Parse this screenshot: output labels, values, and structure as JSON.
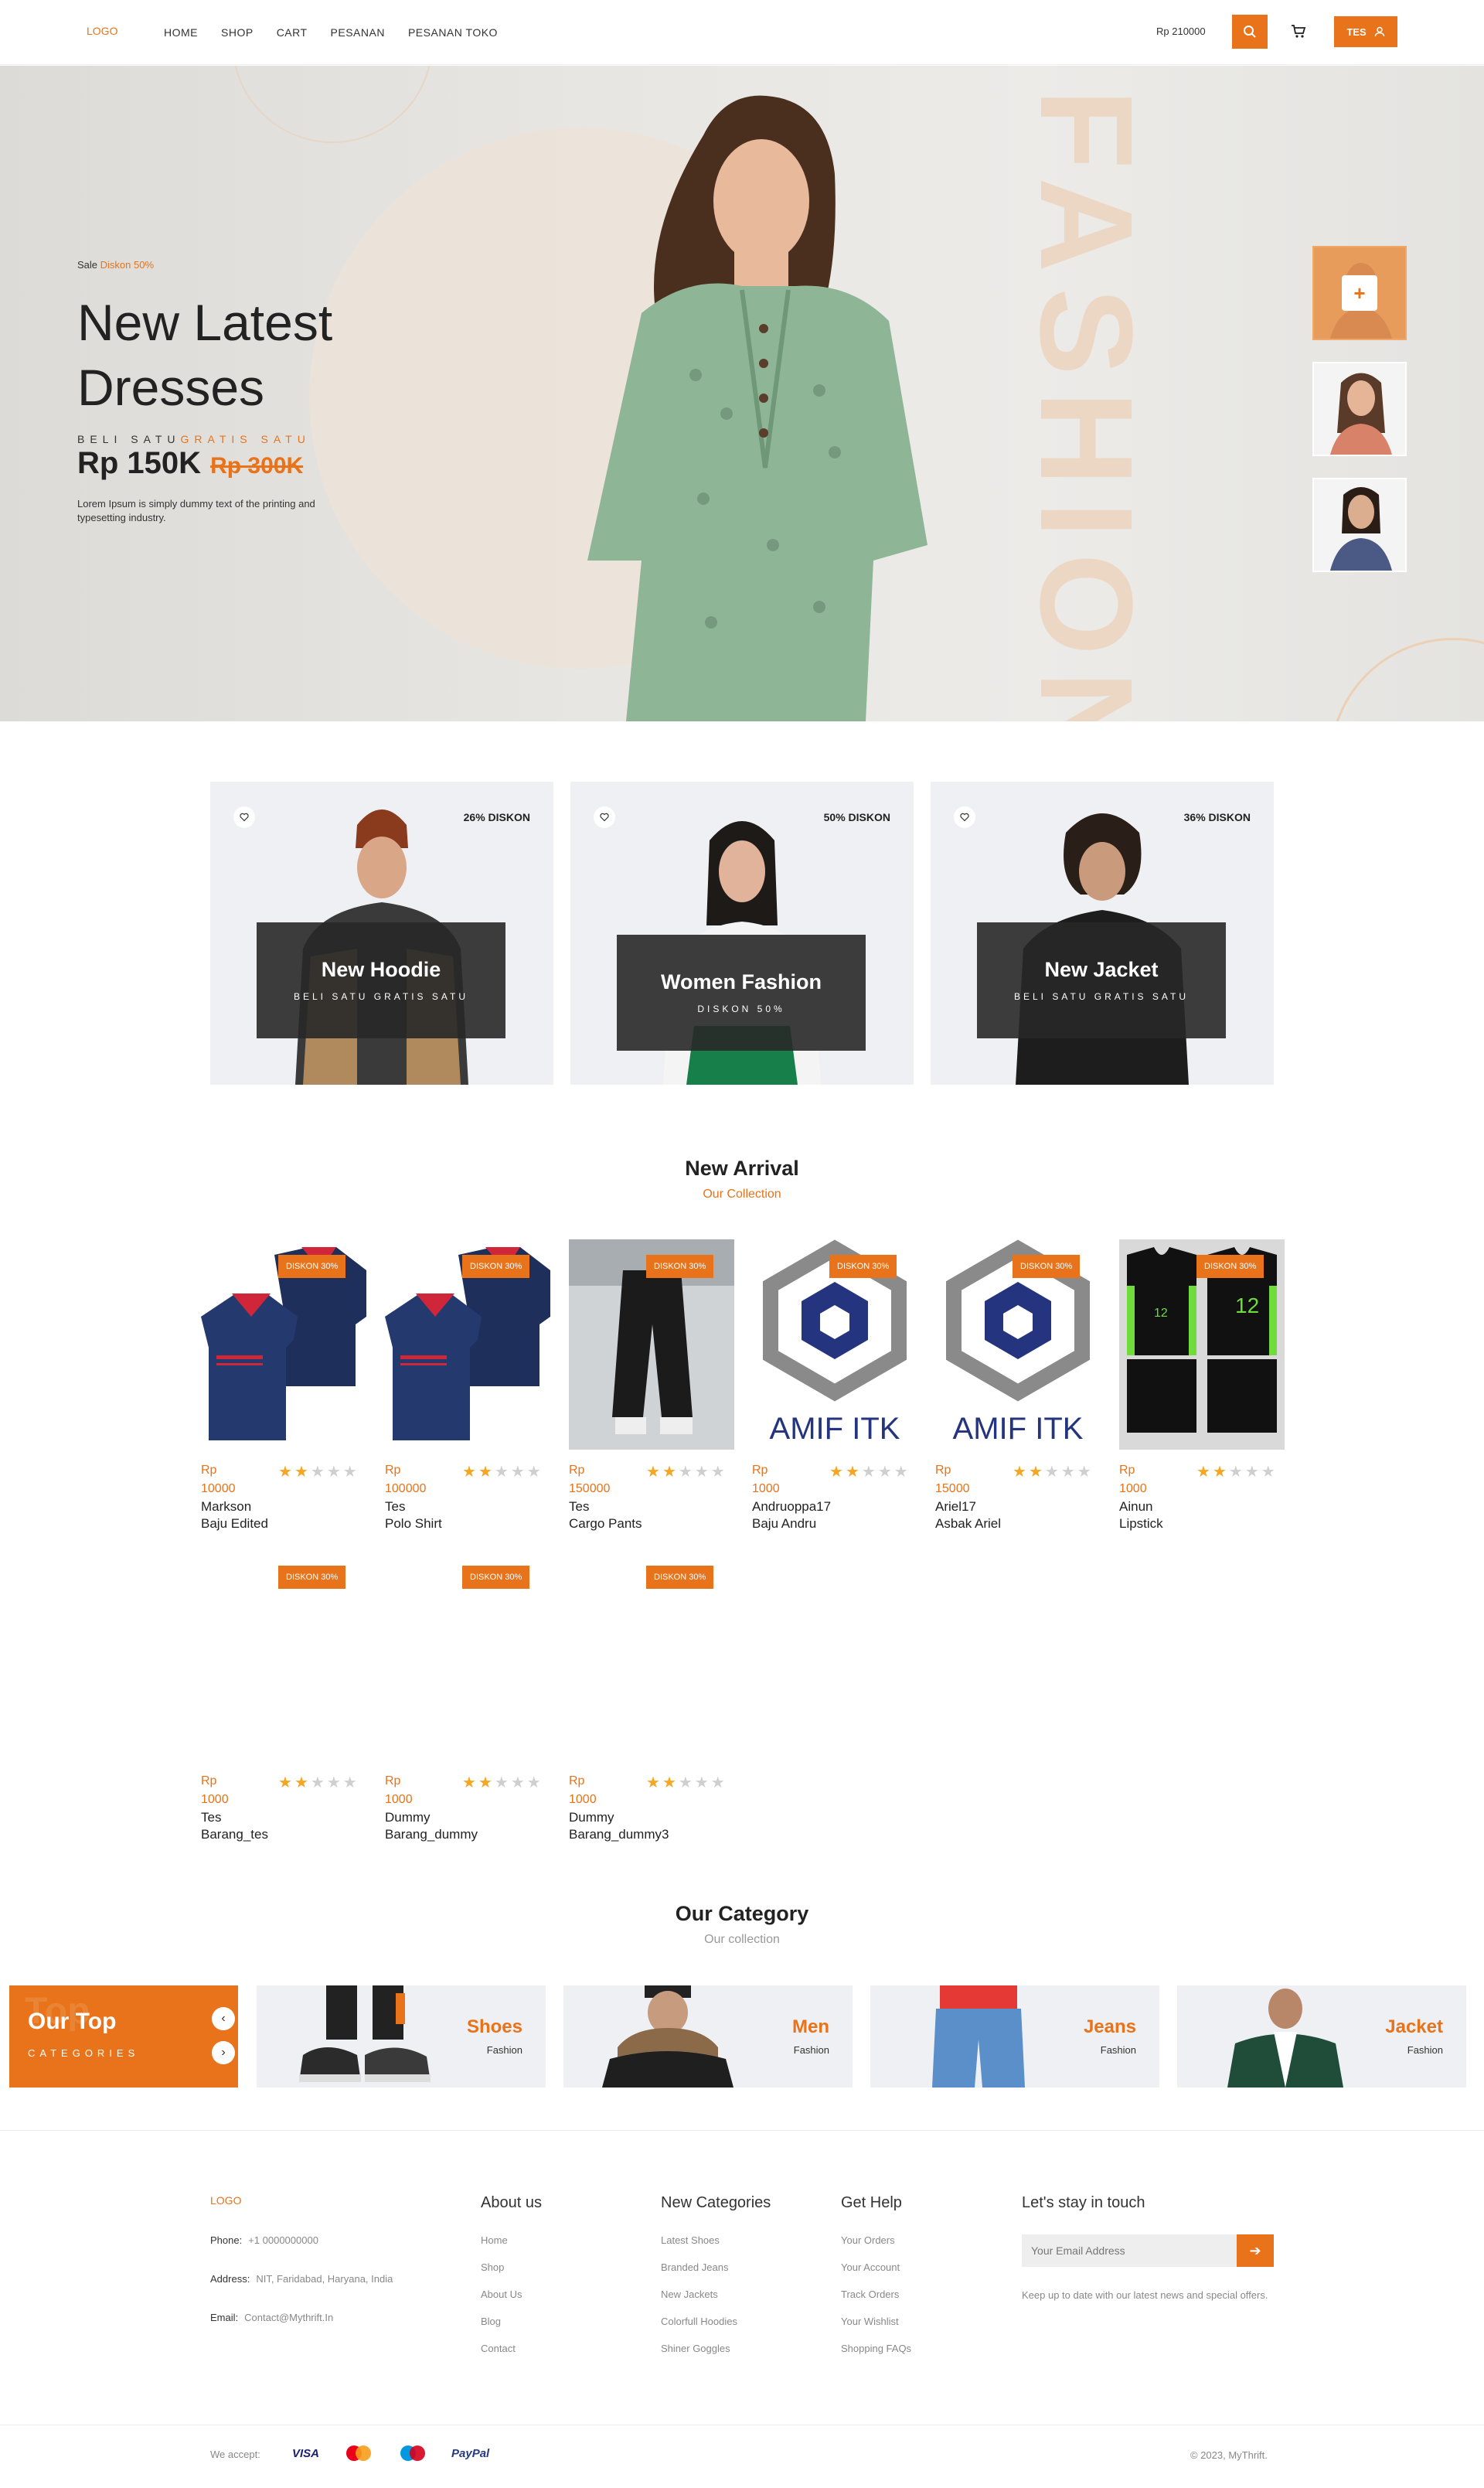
{
  "nav": {
    "logo": "LOGO",
    "menu": [
      "HOME",
      "SHOP",
      "CART",
      "PESANAN",
      "PESANAN TOKO"
    ],
    "balance": "Rp 210000",
    "user": "TES"
  },
  "hero": {
    "sale_label": "Sale",
    "sale_value": "Diskon 50%",
    "title_line1": "New Latest",
    "title_line2": "Dresses",
    "promo_a": "BELI SATU",
    "promo_b": "GRATIS SATU",
    "price": "Rp 150K",
    "old_price": "Rp 300K",
    "description": "Lorem Ipsum is simply dummy text of the printing and typesetting industry.",
    "big_word": "FASHION"
  },
  "promo_cards": [
    {
      "badge": "26% DISKON",
      "title": "New Hoodie",
      "subtitle": "BELI SATU GRATIS SATU"
    },
    {
      "badge": "50% DISKON",
      "title": "Women Fashion",
      "subtitle": "DISKON 50%"
    },
    {
      "badge": "36% DISKON",
      "title": "New Jacket",
      "subtitle": "BELI SATU GRATIS SATU"
    }
  ],
  "new_arrival": {
    "title": "New Arrival",
    "subtitle": "Our Collection"
  },
  "products": [
    {
      "badge": "DISKON 30%",
      "currency": "Rp",
      "price": "10000",
      "owner": "Markson",
      "name": "Baju Edited",
      "rating": 2,
      "image": "polo"
    },
    {
      "badge": "DISKON 30%",
      "currency": "Rp",
      "price": "100000",
      "owner": "Tes",
      "name": "Polo Shirt",
      "rating": 2,
      "image": "polo"
    },
    {
      "badge": "DISKON 30%",
      "currency": "Rp",
      "price": "150000",
      "owner": "Tes",
      "name": "Cargo Pants",
      "rating": 2,
      "image": "pants"
    },
    {
      "badge": "DISKON 30%",
      "currency": "Rp",
      "price": "1000",
      "owner": "Andruoppa17",
      "name": "Baju Andru",
      "rating": 2,
      "image": "logo",
      "logo_text": "AMIF ITK"
    },
    {
      "badge": "DISKON 30%",
      "currency": "Rp",
      "price": "15000",
      "owner": "Ariel17",
      "name": "Asbak Ariel",
      "rating": 2,
      "image": "logo",
      "logo_text": "AMIF ITK"
    },
    {
      "badge": "DISKON 30%",
      "currency": "Rp",
      "price": "1000",
      "owner": "Ainun",
      "name": "Lipstick",
      "rating": 2,
      "image": "jersey"
    },
    {
      "badge": "DISKON 30%",
      "currency": "Rp",
      "price": "1000",
      "owner": "Tes",
      "name": "Barang_tes",
      "rating": 2,
      "image": "none"
    },
    {
      "badge": "DISKON 30%",
      "currency": "Rp",
      "price": "1000",
      "owner": "Dummy",
      "name": "Barang_dummy",
      "rating": 2,
      "image": "none"
    },
    {
      "badge": "DISKON 30%",
      "currency": "Rp",
      "price": "1000",
      "owner": "Dummy",
      "name": "Barang_dummy3",
      "rating": 2,
      "image": "none"
    }
  ],
  "category": {
    "title": "Our Category",
    "subtitle": "Our collection",
    "lead_title": "Our Top",
    "lead_subtitle": "CATEGORIES",
    "lead_ghost": "Top",
    "items": [
      {
        "title": "Shoes",
        "subtitle": "Fashion"
      },
      {
        "title": "Men",
        "subtitle": "Fashion"
      },
      {
        "title": "Jeans",
        "subtitle": "Fashion"
      },
      {
        "title": "Jacket",
        "subtitle": "Fashion"
      }
    ]
  },
  "footer": {
    "logo": "LOGO",
    "phone_label": "Phone:",
    "phone": "+1 0000000000",
    "address_label": "Address:",
    "address": "NIT, Faridabad, Haryana, India",
    "email_label": "Email:",
    "email": "Contact@Mythrift.In",
    "columns": [
      {
        "title": "About us",
        "links": [
          "Home",
          "Shop",
          "About Us",
          "Blog",
          "Contact"
        ]
      },
      {
        "title": "New Categories",
        "links": [
          "Latest Shoes",
          "Branded Jeans",
          "New Jackets",
          "Colorfull Hoodies",
          "Shiner Goggles"
        ]
      },
      {
        "title": "Get Help",
        "links": [
          "Your Orders",
          "Your Account",
          "Track Orders",
          "Your Wishlist",
          "Shopping FAQs"
        ]
      }
    ],
    "newsletter_title": "Let's stay in touch",
    "newsletter_placeholder": "Your Email Address",
    "newsletter_note": "Keep up to date with our latest news and special offers.",
    "we_accept": "We accept:",
    "payments": [
      "VISA",
      "mastercard",
      "maestro",
      "PayPal"
    ],
    "copyright": "© 2023, MyThrift."
  },
  "colors": {
    "accent": "#e8731a",
    "card_bg": "#eef0f4"
  }
}
